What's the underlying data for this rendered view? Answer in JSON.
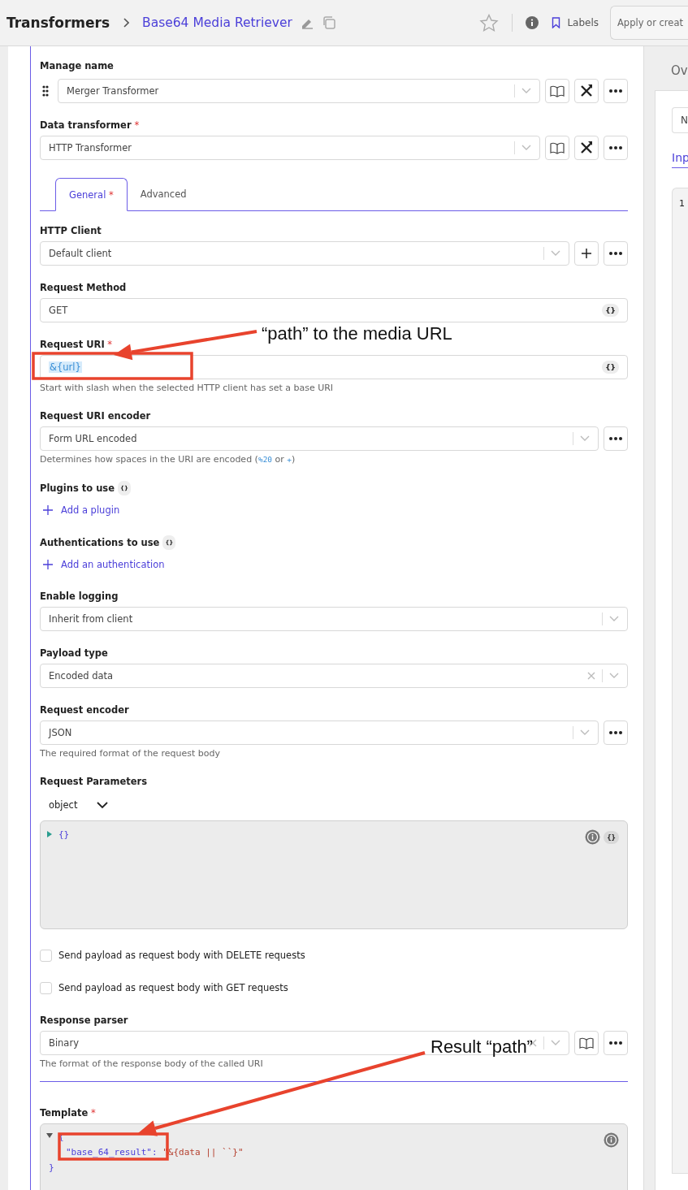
{
  "header": {
    "title": "Transformers",
    "subtitle": "Base64 Media Retriever",
    "labels_button": "Labels",
    "tag_field": {
      "placeholder": "Apply or creat"
    }
  },
  "manage_name": {
    "label": "Manage name",
    "value": "Merger Transformer"
  },
  "data_transformer": {
    "label": "Data transformer",
    "required_mark": "*",
    "value": "HTTP Transformer"
  },
  "tabs": [
    {
      "label": "General",
      "required_mark": "*",
      "selected": true
    },
    {
      "label": "Advanced",
      "selected": false
    }
  ],
  "fields": [
    {
      "kind": "select",
      "label": "HTTP Client",
      "value": "Default client",
      "add_button": true,
      "more_button": true
    },
    {
      "kind": "text",
      "label": "Request Method",
      "value": "GET",
      "code_badge": "{}"
    },
    {
      "kind": "text",
      "label": "Request URI",
      "required_mark": "*",
      "value": "&{url}",
      "highlighted": true,
      "code_badge": "{}",
      "hint": [
        {
          "text": "Start with slash when the selected HTTP client has set a base URI",
          "code": false
        }
      ]
    },
    {
      "kind": "select",
      "label": "Request URI encoder",
      "value": "Form URL encoded",
      "more_button": true,
      "hint": [
        {
          "text": "Determines how spaces in the URI are encoded (",
          "code": false
        },
        {
          "text": "%20",
          "code": true
        },
        {
          "text": " or ",
          "code": false
        },
        {
          "text": "+",
          "code": true
        },
        {
          "text": ")",
          "code": false
        }
      ]
    },
    {
      "kind": "add",
      "label": "Plugins to use",
      "info_badge": "{}",
      "link": "Add a plugin"
    },
    {
      "kind": "add",
      "label": "Authentications to use",
      "info_badge": "{}",
      "link": "Add an authentication"
    },
    {
      "kind": "select",
      "label": "Enable logging",
      "value": "Inherit from client"
    },
    {
      "kind": "select",
      "label": "Payload type",
      "value": "Encoded data",
      "clearable": true
    },
    {
      "kind": "select",
      "label": "Request encoder",
      "value": "JSON",
      "more_button": true,
      "hint": [
        {
          "text": "The required format of the request body",
          "code": false
        }
      ]
    },
    {
      "kind": "object",
      "label": "Request Parameters",
      "type": "object",
      "code": "{}",
      "code_badge": "{}"
    },
    {
      "kind": "checkbox",
      "label": "Send payload as request body with DELETE requests",
      "checked": false
    },
    {
      "kind": "checkbox",
      "label": "Send payload as request body with GET requests",
      "checked": false
    },
    {
      "kind": "select",
      "label": "Response parser",
      "value": "Binary",
      "clearable": true,
      "docs_button": true,
      "more_button": true,
      "hint": [
        {
          "text": "The format of the response body of the called URI",
          "code": false
        }
      ]
    },
    {
      "kind": "divider"
    },
    {
      "kind": "template",
      "label": "Template",
      "required_mark": "*",
      "lines": [
        [
          {
            "text": "{",
            "kind": "punct"
          }
        ],
        [
          {
            "text": "\"base_64_result\"",
            "kind": "key"
          },
          {
            "text": ":",
            "kind": "punct"
          },
          {
            "text": " \"&{data || ``}\"",
            "kind": "string"
          }
        ],
        [
          {
            "text": "}",
            "kind": "punct"
          }
        ]
      ]
    }
  ],
  "side_panel": {
    "heading": "Ov",
    "field": "N",
    "tab": "Inp",
    "line_number": "1"
  },
  "annotations": [
    {
      "text": "“path” to the media URL"
    },
    {
      "text": "Result “path”"
    }
  ]
}
